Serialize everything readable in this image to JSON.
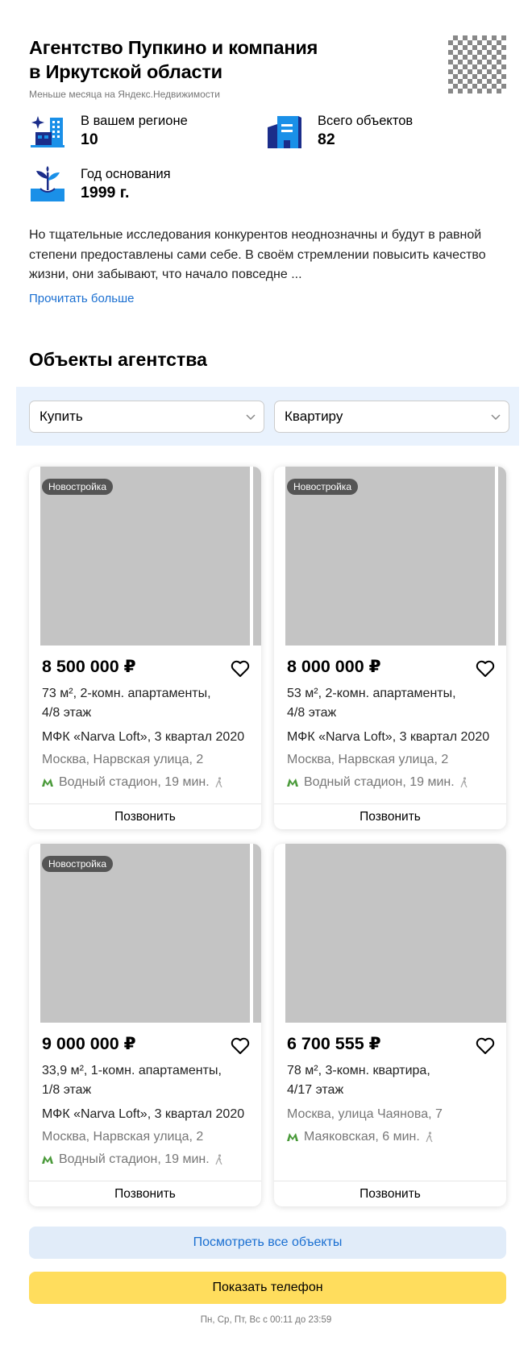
{
  "agency": {
    "title_line1": "Агентство Пупкино и компания",
    "title_line2": "в Иркутской области",
    "subtitle": "Меньше месяца на Яндекс.Недвижимости"
  },
  "stats": {
    "region": {
      "label": "В вашем регионе",
      "value": "10"
    },
    "total": {
      "label": "Всего объектов",
      "value": "82"
    },
    "founded": {
      "label": "Год основания",
      "value": "1999 г."
    }
  },
  "description": "Но тщательные исследования конкурентов неоднозначны и будут в равной степени предоставлены сами себе. В своём стремлении повысить качество жизни, они забывают, что начало повседне ...",
  "read_more": "Прочитать больше",
  "section_title": "Объекты агентства",
  "filters": {
    "deal_type": "Купить",
    "property_type": "Квартиру"
  },
  "listings": [
    {
      "badge": "Новостройка",
      "price": "8 500 000 ₽",
      "area_line1": "73 м², 2-комн. апартаменты,",
      "area_line2": "4/8 этаж",
      "complex": "МФК «Narva Loft», 3 квартал 2020",
      "address": "Москва, Нарвская улица, 2",
      "metro": "Водный стадион, 19 мин.",
      "call": "Позвонить"
    },
    {
      "badge": "Новостройка",
      "price": "8 000 000 ₽",
      "area_line1": "53 м², 2-комн. апартаменты,",
      "area_line2": "4/8 этаж",
      "complex": "МФК «Narva Loft», 3 квартал 2020",
      "address": "Москва, Нарвская улица, 2",
      "metro": "Водный стадион, 19 мин.",
      "call": "Позвонить"
    },
    {
      "badge": "Новостройка",
      "price": "9 000 000 ₽",
      "area_line1": "33,9 м², 1-комн. апартаменты,",
      "area_line2": "1/8 этаж",
      "complex": "МФК «Narva Loft», 3 квартал 2020",
      "address": "Москва, Нарвская улица, 2",
      "metro": "Водный стадион, 19 мин.",
      "call": "Позвонить"
    },
    {
      "price": "6 700 555 ₽",
      "area_line1": "78 м², 3-комн. квартира,",
      "area_line2": "4/17 этаж",
      "address": "Москва, улица Чаянова, 7",
      "metro": "Маяковская, 6 мин.",
      "call": "Позвонить"
    }
  ],
  "buttons": {
    "view_all": "Посмотреть все объекты",
    "show_phone": "Показать телефон"
  },
  "hours": "Пн, Ср, Пт, Вс с 00:11 до 23:59",
  "colors": {
    "link": "#1a6fd1",
    "filter_bg": "#e9f2fd",
    "phone_button": "#ffdd5d",
    "metro_green": "#4a9a3a",
    "icon_blue": "#1a90e8",
    "icon_navy": "#1b2d8a"
  }
}
